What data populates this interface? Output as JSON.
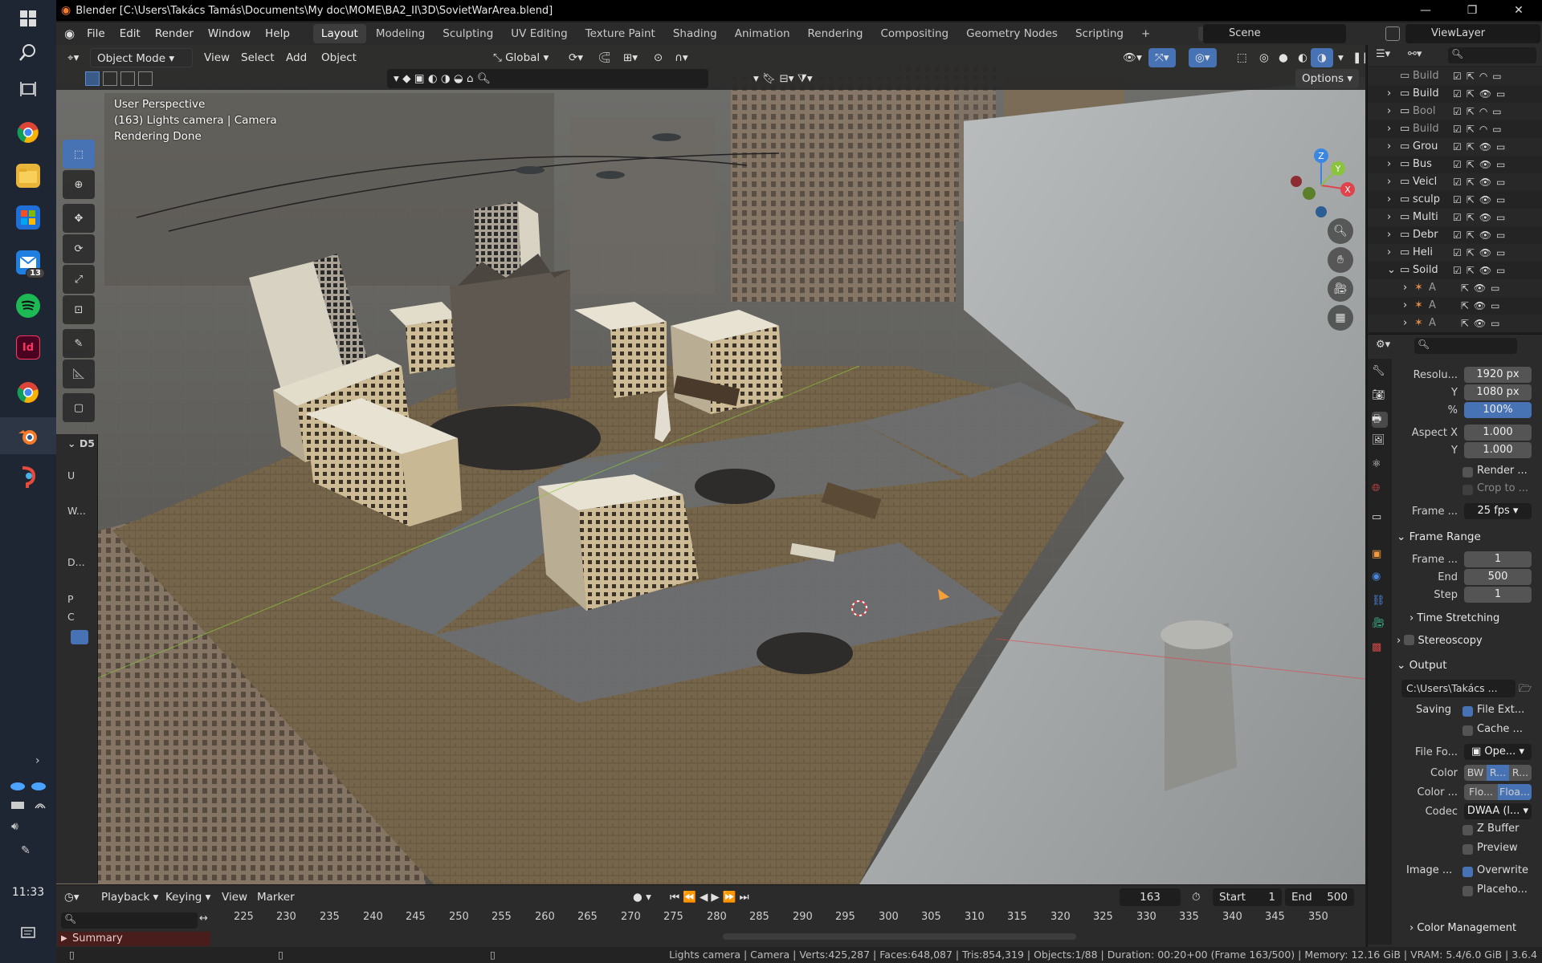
{
  "taskbar": {
    "time": "11:33",
    "mail_badge": "13",
    "items": [
      "windows-start",
      "search",
      "task-view",
      "chrome",
      "file-explorer",
      "store",
      "mail",
      "spotify",
      "indesign",
      "chrome-2",
      "blender",
      "app-red"
    ]
  },
  "titlebar": {
    "title": "Blender [C:\\Users\\Takács Tamás\\Documents\\My doc\\MOME\\BA2_II\\3D\\SovietWarArea.blend]"
  },
  "menu": {
    "items": [
      "File",
      "Edit",
      "Render",
      "Window",
      "Help"
    ],
    "workspaces": [
      "Layout",
      "Modeling",
      "Sculpting",
      "UV Editing",
      "Texture Paint",
      "Shading",
      "Animation",
      "Rendering",
      "Compositing",
      "Geometry Nodes",
      "Scripting"
    ],
    "active_workspace": "Layout",
    "add_workspace": "+",
    "scene": "Scene",
    "view_layer": "ViewLayer"
  },
  "viewport": {
    "mode": "Object Mode",
    "menus": [
      "View",
      "Select",
      "Add",
      "Object"
    ],
    "orientation": "Global",
    "options": "Options",
    "overlay_lines": [
      "User Perspective",
      "(163) Lights camera | Camera",
      "Rendering Done"
    ],
    "npanel": {
      "header": "D5",
      "labels": [
        "U",
        "W...",
        "D...",
        "P",
        "C"
      ]
    },
    "gizmo": {
      "x": "X",
      "y": "Y",
      "z": "Z"
    }
  },
  "timeline": {
    "menus": [
      "Playback",
      "Keying",
      "View",
      "Marker"
    ],
    "current_frame": "163",
    "start_label": "Start",
    "start": "1",
    "end_label": "End",
    "end": "500",
    "ticks": [
      "225",
      "230",
      "235",
      "240",
      "245",
      "250",
      "255",
      "260",
      "265",
      "270",
      "275",
      "280",
      "285",
      "290",
      "295",
      "300",
      "305",
      "310",
      "315",
      "320",
      "325",
      "330",
      "335",
      "340",
      "345",
      "350"
    ],
    "summary": "Summary"
  },
  "statusbar": {
    "text": "Lights camera | Camera | Verts:425,287 | Faces:648,087 | Tris:854,319 | Objects:1/88 | Duration: 00:20+00 (Frame 163/500) | Memory: 12.16 GiB | VRAM: 5.4/6.0 GiB | 3.6.4"
  },
  "outliner": {
    "rows": [
      "Build",
      "Build",
      "Bool",
      "Build",
      "Grou",
      "Bus",
      "Veicl",
      "sculp",
      "Multi",
      "Debr",
      "Heli",
      "Soild",
      "A",
      "A",
      "A"
    ]
  },
  "properties": {
    "resolution_x_label": "Resolu...",
    "resolution_x": "1920 px",
    "resolution_y_label": "Y",
    "resolution_y": "1080 px",
    "percent_label": "%",
    "percent": "100%",
    "aspect_x_label": "Aspect X",
    "aspect_x": "1.000",
    "aspect_y_label": "Y",
    "aspect_y": "1.000",
    "render_region": "Render ...",
    "crop": "Crop to ...",
    "frame_rate_label": "Frame ...",
    "frame_rate": "25 fps",
    "frame_range_header": "Frame Range",
    "frame_start_label": "Frame ...",
    "frame_start": "1",
    "frame_end_label": "End",
    "frame_end": "500",
    "frame_step_label": "Step",
    "frame_step": "1",
    "time_stretching": "Time Stretching",
    "stereoscopy": "Stereoscopy",
    "output_header": "Output",
    "output_path": "C:\\Users\\Takács ...",
    "saving_label": "Saving",
    "file_ext": "File Ext...",
    "cache": "Cache ...",
    "file_format_label": "File Fo...",
    "file_format": "Ope...",
    "color_label": "Color",
    "color_opts": [
      "BW",
      "R...",
      "R..."
    ],
    "color_depth_label": "Color ...",
    "color_depth_opts": [
      "Flo...",
      "Floa..."
    ],
    "codec_label": "Codec",
    "codec": "DWAA (l...",
    "z_buffer": "Z Buffer",
    "preview": "Preview",
    "image_label": "Image ...",
    "overwrite": "Overwrite",
    "placeholders": "Placeho...",
    "color_management": "Color Management"
  },
  "colors": {
    "accent": "#4772b3",
    "blender_orange": "#f5792a",
    "axis_x": "#e0434b",
    "axis_y": "#8ac33d",
    "axis_z": "#3a86e0"
  }
}
